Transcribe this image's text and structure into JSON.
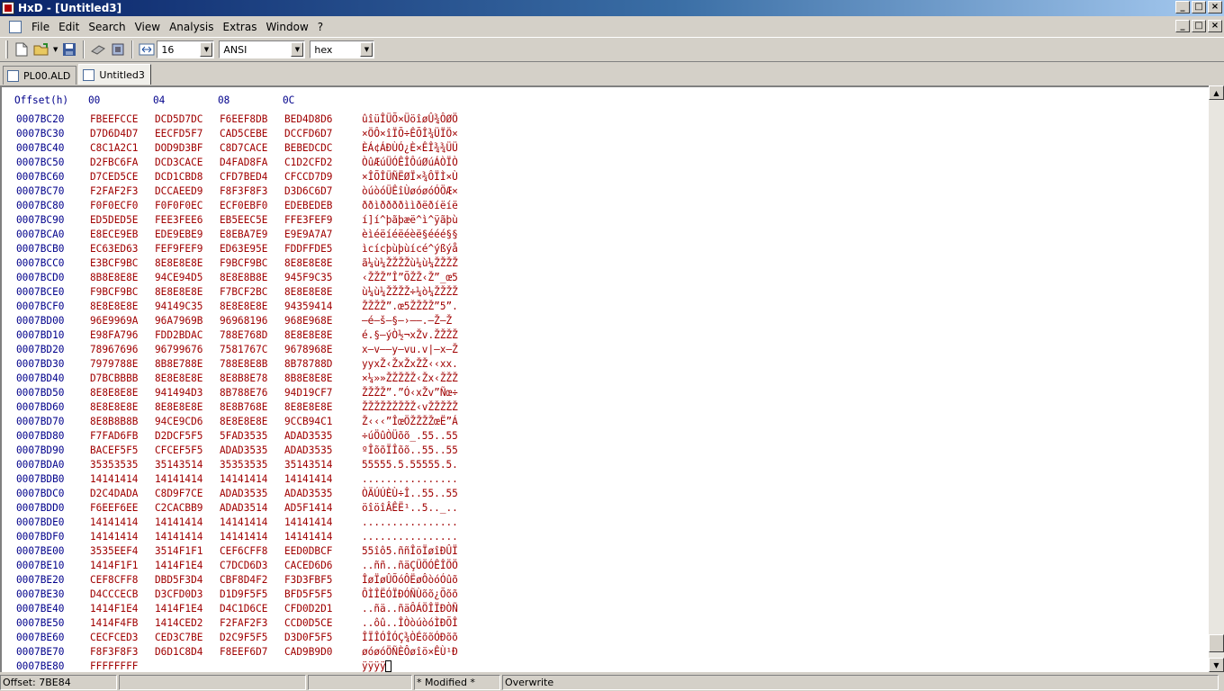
{
  "window": {
    "title": "HxD - [Untitled3]",
    "min": "_",
    "max": "□",
    "close": "×"
  },
  "menu": [
    "File",
    "Edit",
    "Search",
    "View",
    "Analysis",
    "Extras",
    "Window",
    "?"
  ],
  "toolbar": {
    "bytes_per_row": "16",
    "charset": "ANSI",
    "display_mode": "hex"
  },
  "tabs": [
    "PL00.ALD",
    "Untitled3"
  ],
  "hex_header": {
    "offset_label": "Offset(h)",
    "columns": [
      "00",
      "04",
      "08",
      "0C"
    ]
  },
  "rows": [
    [
      "0007BC20",
      "FBEEFCCE",
      "DCD5D7DC",
      "F6EEF8DB",
      "BED4D8D6",
      "ûîüÎÜÕ×ÜöîøÛ¾ÔØÖ"
    ],
    [
      "0007BC30",
      "D7D6D4D7",
      "EECFD5F7",
      "CAD5CEBE",
      "DCCFD6D7",
      "×ÖÔ×îÏÕ÷ÊÕÎ¾ÜÏÖ×"
    ],
    [
      "0007BC40",
      "C8C1A2C1",
      "DOD9D3BF",
      "C8D7CACE",
      "BEBEDCDC",
      "ÈÁ¢ÁÐÙÓ¿È×ÊÎ¾¾ÜÜ"
    ],
    [
      "0007BC50",
      "D2FBC6FA",
      "DCD3CACE",
      "D4FAD8FA",
      "C1D2CFD2",
      "ÒûÆúÜÓÊÎÔúØúÁÒÏÒ"
    ],
    [
      "0007BC60",
      "D7CED5CE",
      "DCD1CBD8",
      "CFD7BED4",
      "CFCCD7D9",
      "×ÎÕÎÜÑËØÏ×¾ÔÏÌ×Ù"
    ],
    [
      "0007BC70",
      "F2FAF2F3",
      "DCCAEED9",
      "F8F3F8F3",
      "D3D6C6D7",
      "òúòóÜÊîÙøóøóÓÖÆ×"
    ],
    [
      "0007BC80",
      "F0F0ECF0",
      "F0F0F0EC",
      "ECF0EBF0",
      "EDEBEDEB",
      "ððìððððììðëðíëíë"
    ],
    [
      "0007BC90",
      "ED5DED5E",
      "FEE3FEE6",
      "EB5EEC5E",
      "FFE3FEF9",
      "í]í^þãþæë^ì^ÿãþù"
    ],
    [
      "0007BCA0",
      "E8ECE9EB",
      "EDE9EBE9",
      "E8EBA7E9",
      "E9E9A7A7",
      "èìéëíéëéèë§ééé§§"
    ],
    [
      "0007BCB0",
      "EC63ED63",
      "FEF9FEF9",
      "ED63E95E",
      "FDDFFDE5",
      "ìcícþùþùícé^ýßýå"
    ],
    [
      "0007BCC0",
      "E3BCF9BC",
      "8E8E8E8E",
      "F9BCF9BC",
      "8E8E8E8E",
      "ã¼ù¼ŽŽŽŽù¼ù¼ŽŽŽŽ"
    ],
    [
      "0007BCD0",
      "8B8E8E8E",
      "94CE94D5",
      "8E8E8B8E",
      "945F9C35",
      "‹ŽŽŽ”Î”ÕŽŽ‹Ž”_œ5"
    ],
    [
      "0007BCE0",
      "F9BCF9BC",
      "8E8E8E8E",
      "F7BCF2BC",
      "8E8E8E8E",
      "ù¼ù¼ŽŽŽŽ÷¼ò¼ŽŽŽŽ"
    ],
    [
      "0007BCF0",
      "8E8E8E8E",
      "94149C35",
      "8E8E8E8E",
      "94359414",
      "ŽŽŽŽ”.œ5ŽŽŽŽ”5”."
    ],
    [
      "0007BD00",
      "96E9969A",
      "96A7969B",
      "96968196",
      "968E968E",
      "–é–š–§–›––.–Ž–Ž"
    ],
    [
      "0007BD10",
      "E98FA796",
      "FDD2BDAC",
      "788E768D",
      "8E8E8E8E",
      "é.§–ýÒ½¬xŽv.ŽŽŽŽ"
    ],
    [
      "0007BD20",
      "78967696",
      "96799676",
      "7581767C",
      "9678968E",
      "x–v––y–vu.v|–x–Ž"
    ],
    [
      "0007BD30",
      "7979788E",
      "8B8E788E",
      "788E8E8B",
      "8B78788D",
      "yyxŽ‹ŽxŽxŽŽ‹‹xx."
    ],
    [
      "0007BD40",
      "D7BCBBBB",
      "8E8E8E8E",
      "8E8B8E78",
      "8B8E8E8E",
      "×¼»»ŽŽŽŽŽ‹Žx‹ŽŽŽ"
    ],
    [
      "0007BD50",
      "8E8E8E8E",
      "941494D3",
      "8B788E76",
      "94D19CF7",
      "ŽŽŽŽ”.”Ó‹xŽv”Ñœ÷"
    ],
    [
      "0007BD60",
      "8E8E8E8E",
      "8E8E8E8E",
      "8E8B768E",
      "8E8E8E8E",
      "ŽŽŽŽŽŽŽŽŽ‹vŽŽŽŽŽ"
    ],
    [
      "0007BD70",
      "8E8B8B8B",
      "94CE9CD6",
      "8E8E8E8E",
      "9CCB94C1",
      "Ž‹‹‹”ÎœÖŽŽŽŽœË”Á"
    ],
    [
      "0007BD80",
      "F7FAD6FB",
      "D2DCF5F5",
      "5FAD3535",
      "ADAD3535",
      "÷úÖûÒÜõõ_.55..55"
    ],
    [
      "0007BD90",
      "BACEF5F5",
      "CFCEF5F5",
      "ADAD3535",
      "ADAD3535",
      "ºÎõõÏÎõõ..55..55"
    ],
    [
      "0007BDA0",
      "35353535",
      "35143514",
      "35353535",
      "35143514",
      "55555.5.55555.5."
    ],
    [
      "0007BDB0",
      "14141414",
      "14141414",
      "14141414",
      "14141414",
      "................"
    ],
    [
      "0007BDC0",
      "D2C4DADA",
      "C8D9F7CE",
      "ADAD3535",
      "ADAD3535",
      "ÒÄÚÚÈÙ÷Î..55..55"
    ],
    [
      "0007BDD0",
      "F6EEF6EE",
      "C2CACBB9",
      "ADAD3514",
      "AD5F1414",
      "öîöîÂÊË¹..5.._.."
    ],
    [
      "0007BDE0",
      "14141414",
      "14141414",
      "14141414",
      "14141414",
      "................"
    ],
    [
      "0007BDF0",
      "14141414",
      "14141414",
      "14141414",
      "14141414",
      "................"
    ],
    [
      "0007BE00",
      "3535EEF4",
      "3514F1F1",
      "CEF6CFF8",
      "EED0DBCF",
      "55îô5.ññÎöÏøîÐÛÏ"
    ],
    [
      "0007BE10",
      "1414F1F1",
      "1414F1E4",
      "C7DCD6D3",
      "CACED6D6",
      "..ññ..ñäÇÜÖÓÊÎÖÖ"
    ],
    [
      "0007BE20",
      "CEF8CFF8",
      "DBD5F3D4",
      "CBF8D4F2",
      "F3D3FBF5",
      "ÎøÏøÛÕóÔËøÔòóÓûõ"
    ],
    [
      "0007BE30",
      "D4CCCECB",
      "D3CFD0D3",
      "D1D9F5F5",
      "BFD5F5F5",
      "ÔÌÎËÓÏÐÓÑÙõõ¿Õõõ"
    ],
    [
      "0007BE40",
      "1414F1E4",
      "1414F1E4",
      "D4C1D6CE",
      "CFD0D2D1",
      "..ñä..ñäÔÁÖÎÏÐÒÑ"
    ],
    [
      "0007BE50",
      "1414F4FB",
      "1414CED2",
      "F2FAF2F3",
      "CCD0D5CE",
      "..ôû..ÎÒòúòóÌÐÕÎ"
    ],
    [
      "0007BE60",
      "CECFCED3",
      "CED3C7BE",
      "D2C9F5F5",
      "D3D0F5F5",
      "ÎÏÎÓÎÓÇ¾ÒÉõõÓÐõõ"
    ],
    [
      "0007BE70",
      "F8F3F8F3",
      "D6D1C8D4",
      "F8EEF6D7",
      "CAD9B9D0",
      "øóøóÖÑÈÔøîö×ÊÙ¹Ð"
    ],
    [
      "0007BE80",
      "FFFFFFFF",
      "",
      "",
      "",
      "ÿÿÿÿ"
    ]
  ],
  "status": {
    "offset": "Offset: 7BE84",
    "modified": "* Modified *",
    "mode": "Overwrite"
  }
}
